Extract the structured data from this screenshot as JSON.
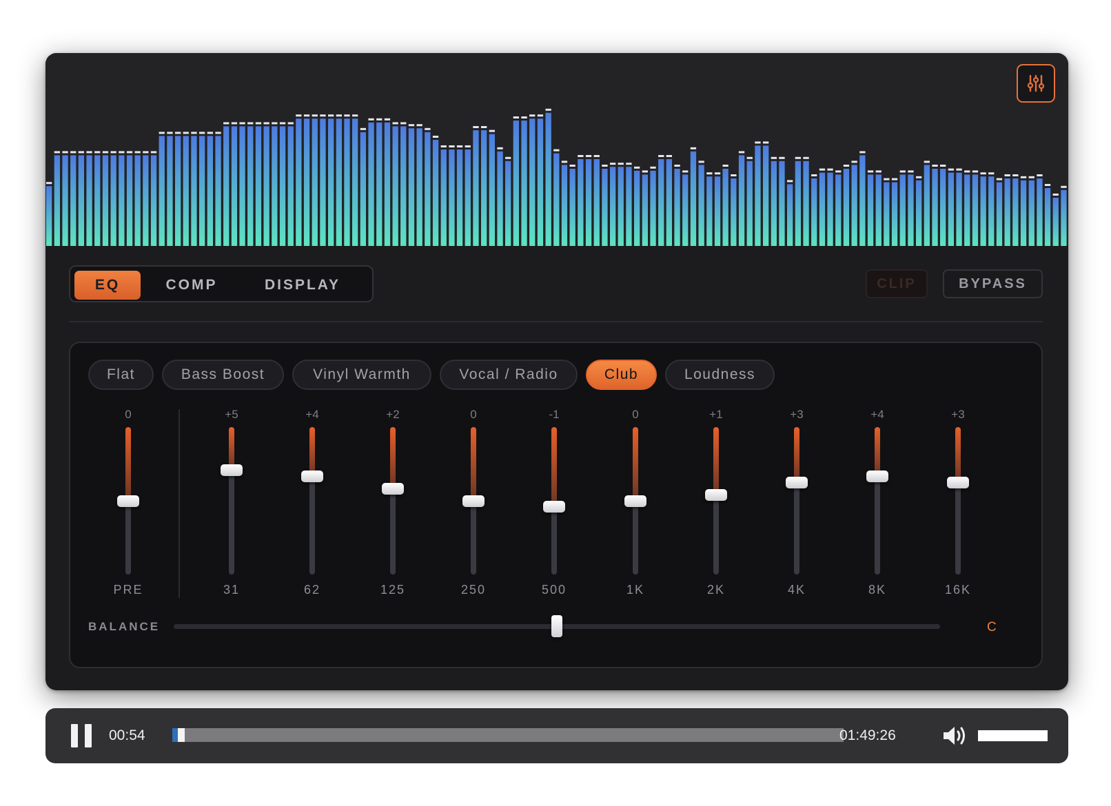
{
  "header": {
    "visualizer": {
      "levels": [
        0.31,
        0.47,
        0.47,
        0.47,
        0.47,
        0.47,
        0.47,
        0.47,
        0.47,
        0.47,
        0.47,
        0.47,
        0.47,
        0.47,
        0.57,
        0.57,
        0.57,
        0.57,
        0.57,
        0.57,
        0.57,
        0.57,
        0.62,
        0.62,
        0.62,
        0.62,
        0.62,
        0.62,
        0.62,
        0.62,
        0.62,
        0.66,
        0.66,
        0.66,
        0.66,
        0.66,
        0.66,
        0.66,
        0.66,
        0.59,
        0.64,
        0.64,
        0.64,
        0.62,
        0.62,
        0.61,
        0.61,
        0.59,
        0.55,
        0.5,
        0.5,
        0.5,
        0.5,
        0.6,
        0.6,
        0.58,
        0.49,
        0.44,
        0.65,
        0.65,
        0.66,
        0.66,
        0.69,
        0.48,
        0.42,
        0.4,
        0.45,
        0.45,
        0.45,
        0.4,
        0.41,
        0.41,
        0.41,
        0.39,
        0.37,
        0.39,
        0.45,
        0.45,
        0.4,
        0.37,
        0.49,
        0.42,
        0.36,
        0.36,
        0.4,
        0.35,
        0.47,
        0.44,
        0.52,
        0.52,
        0.44,
        0.44,
        0.32,
        0.44,
        0.44,
        0.35,
        0.38,
        0.38,
        0.37,
        0.4,
        0.42,
        0.47,
        0.37,
        0.37,
        0.33,
        0.33,
        0.37,
        0.37,
        0.34,
        0.42,
        0.4,
        0.4,
        0.38,
        0.38,
        0.37,
        0.37,
        0.36,
        0.36,
        0.33,
        0.35,
        0.35,
        0.34,
        0.34,
        0.35,
        0.3,
        0.25,
        0.29
      ]
    }
  },
  "tabs": [
    {
      "label": "EQ",
      "active": true
    },
    {
      "label": "COMP",
      "active": false
    },
    {
      "label": "DISPLAY",
      "active": false
    }
  ],
  "toolbar": {
    "clip_label": "CLIP",
    "bypass_label": "BYPASS"
  },
  "presets": [
    {
      "label": "Flat",
      "active": false
    },
    {
      "label": "Bass Boost",
      "active": false
    },
    {
      "label": "Vinyl Warmth",
      "active": false
    },
    {
      "label": "Vocal / Radio",
      "active": false
    },
    {
      "label": "Club",
      "active": true
    },
    {
      "label": "Loudness",
      "active": false
    }
  ],
  "eq": {
    "range_db": 12,
    "bands": [
      {
        "label": "PRE",
        "value_text": "0",
        "gain": 0
      },
      {
        "label": "31",
        "value_text": "+5",
        "gain": 5
      },
      {
        "label": "62",
        "value_text": "+4",
        "gain": 4
      },
      {
        "label": "125",
        "value_text": "+2",
        "gain": 2
      },
      {
        "label": "250",
        "value_text": "0",
        "gain": 0
      },
      {
        "label": "500",
        "value_text": "-1",
        "gain": -1
      },
      {
        "label": "1K",
        "value_text": "0",
        "gain": 0
      },
      {
        "label": "2K",
        "value_text": "+1",
        "gain": 1
      },
      {
        "label": "4K",
        "value_text": "+3",
        "gain": 3
      },
      {
        "label": "8K",
        "value_text": "+4",
        "gain": 4
      },
      {
        "label": "16K",
        "value_text": "+3",
        "gain": 3
      }
    ]
  },
  "balance": {
    "label": "BALANCE",
    "value_text": "C",
    "position": 0.5
  },
  "player": {
    "elapsed": "00:54",
    "duration": "01:49:26",
    "progress": 0.008,
    "volume": 1.0
  },
  "colors": {
    "accent": "#e8713a",
    "panel": "#1c1c1f",
    "bar_top": "#4f7fdc",
    "bar_bottom": "#5fe0c0",
    "seek_fill": "#2f6fb8"
  },
  "icons": {
    "visualizer_settings": "sliders-icon",
    "play_state": "pause-icon",
    "volume": "speaker-volume-icon"
  }
}
